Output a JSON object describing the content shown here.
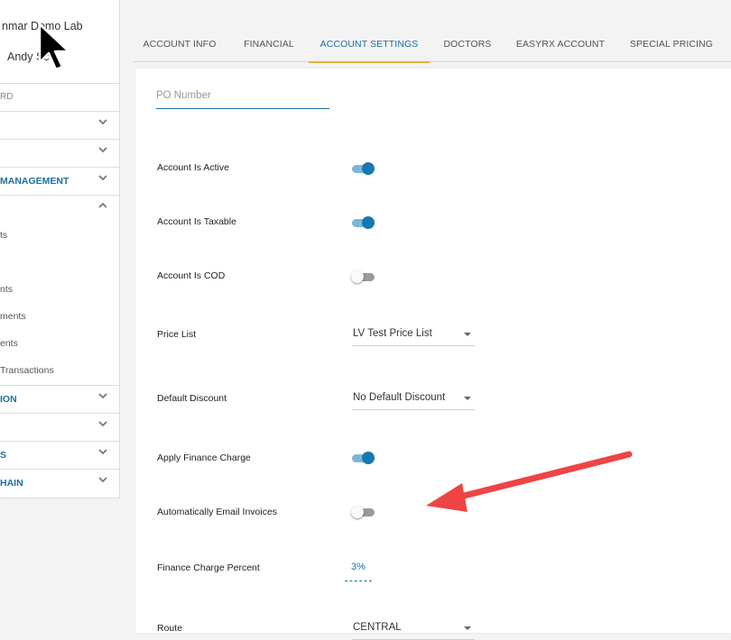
{
  "sidebar": {
    "lab_name": "nmar Demo Lab",
    "user_name": "Andy Sc",
    "items": [
      {
        "label": "RD",
        "style": "gray",
        "chevron": "none"
      },
      {
        "label": "",
        "style": "normal",
        "chevron": "down"
      },
      {
        "label": "",
        "style": "normal",
        "chevron": "down"
      },
      {
        "label": "MANAGEMENT",
        "style": "bold",
        "chevron": "down"
      },
      {
        "label": "",
        "style": "normal",
        "chevron": "up"
      }
    ],
    "sub_items": [
      "ts",
      "",
      "nts",
      "ments",
      "ents",
      "Transactions"
    ],
    "items_bottom": [
      {
        "label": "ION",
        "style": "bold",
        "chevron": "down"
      },
      {
        "label": "",
        "style": "normal",
        "chevron": "down"
      },
      {
        "label": "S",
        "style": "bold",
        "chevron": "down"
      },
      {
        "label": "HAIN",
        "style": "bold",
        "chevron": "down"
      }
    ]
  },
  "tabs": [
    {
      "label": "ACCOUNT INFO",
      "active": false
    },
    {
      "label": "FINANCIAL",
      "active": false
    },
    {
      "label": "ACCOUNT SETTINGS",
      "active": true
    },
    {
      "label": "DOCTORS",
      "active": false
    },
    {
      "label": "EASYRX ACCOUNT",
      "active": false
    },
    {
      "label": "SPECIAL PRICING",
      "active": false
    }
  ],
  "form": {
    "po_number_placeholder": "PO Number",
    "po_number_value": "",
    "account_active": {
      "label": "Account Is Active",
      "on": true
    },
    "account_taxable": {
      "label": "Account Is Taxable",
      "on": true
    },
    "account_cod": {
      "label": "Account Is COD",
      "on": false
    },
    "price_list": {
      "label": "Price List",
      "value": "LV Test Price List"
    },
    "default_discount": {
      "label": "Default Discount",
      "value": "No Default Discount"
    },
    "apply_finance_charge": {
      "label": "Apply Finance Charge",
      "on": true
    },
    "auto_email_invoices": {
      "label": "Automatically Email Invoices",
      "on": false
    },
    "finance_charge_percent": {
      "label": "Finance Charge Percent",
      "value": "3%"
    },
    "route": {
      "label": "Route",
      "value": "CENTRAL"
    }
  },
  "colors": {
    "accent": "#1c6fa0",
    "tab_underline": "#e3b23c",
    "toggle_on_knob": "#1878b0",
    "annotation_arrow": "#ee4444"
  },
  "icons": {
    "chevron": "chevron-icon",
    "cursor": "mouse-cursor-icon",
    "annotation": "annotation-arrow-icon"
  }
}
